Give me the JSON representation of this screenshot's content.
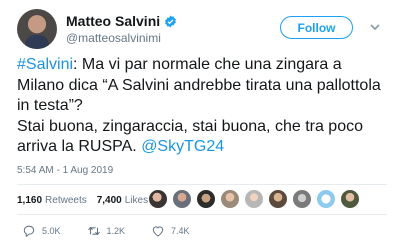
{
  "author": {
    "name": "Matteo Salvini",
    "handle": "@matteosalvinimi"
  },
  "follow_label": "Follow",
  "tweet": {
    "hashtag": "#Salvini",
    "text_part1": ": Ma vi par normale che una zingara a Milano dica “A Salvini andrebbe tirata una pallottola in testa”?\nStai buona, zingaraccia, stai buona, che tra poco arriva la RUSPA. ",
    "mention": "@SkyTG24"
  },
  "timestamp": "5:54 AM - 1 Aug 2019",
  "stats": {
    "retweets_count": "1,160",
    "retweets_label": "Retweets",
    "likes_count": "7,400",
    "likes_label": "Likes"
  },
  "actions": {
    "reply_count": "5.0K",
    "retweet_count": "1.2K",
    "like_count": "7.4K"
  },
  "colors": {
    "accent": "#1da1f2",
    "link": "#1b95e0",
    "muted": "#657786",
    "text": "#14171a"
  },
  "icons": [
    "verified-badge-icon",
    "chevron-down-icon",
    "reply-icon",
    "retweet-icon",
    "heart-icon"
  ]
}
